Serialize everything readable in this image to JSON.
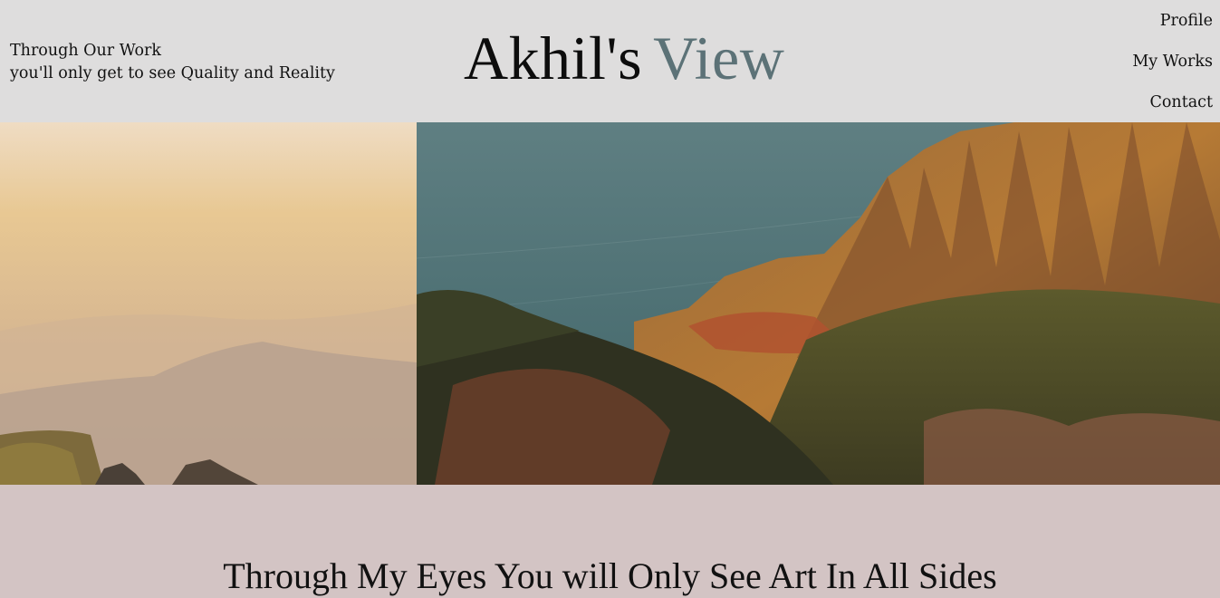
{
  "header": {
    "tagline_line1": "Through Our Work",
    "tagline_line2": "you'll only get to see Quality and Reality",
    "brand_part1": "Akhil's",
    "brand_part2": "View",
    "brand_accent_color": "#5c7277",
    "background_color": "#dedddd"
  },
  "nav": {
    "items": [
      {
        "label": "Profile"
      },
      {
        "label": "My Works"
      },
      {
        "label": "Contact"
      }
    ]
  },
  "gallery": {
    "images": [
      {
        "name": "hazy-mountain-sunset-photo"
      },
      {
        "name": "coastal-cliffs-valley-photo"
      }
    ]
  },
  "main": {
    "heading": "Through My Eyes You will Only See Art In All Sides",
    "background_color": "#d3c4c4"
  }
}
